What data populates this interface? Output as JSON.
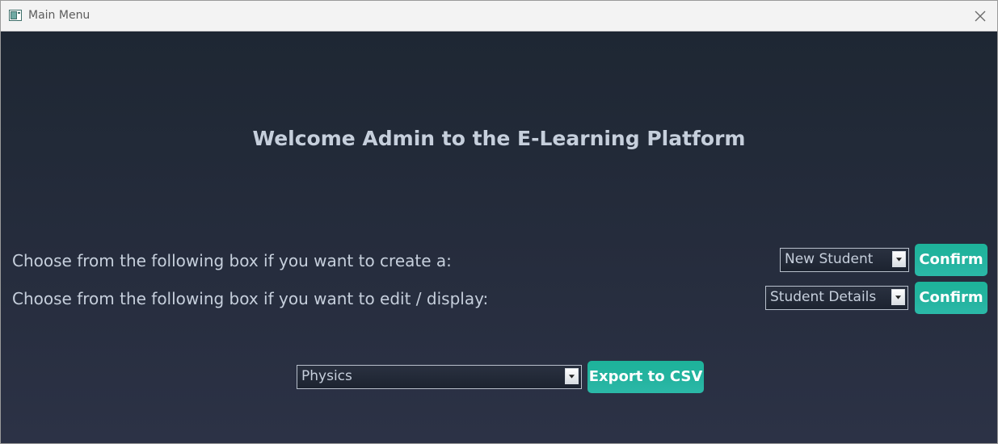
{
  "window": {
    "title": "Main Menu"
  },
  "main": {
    "heading": "Welcome Admin to the E-Learning Platform",
    "create_row": {
      "label": "Choose from the following box if you want to create a:",
      "selected": "New Student",
      "button": "Confirm"
    },
    "edit_row": {
      "label": "Choose from the following box if you want to edit / display:",
      "selected": "Student Details",
      "button": "Confirm"
    },
    "export_row": {
      "selected": "Physics",
      "button": "Export to CSV"
    }
  },
  "colors": {
    "background_top": "#1e2733",
    "background_bottom": "#2c3246",
    "text": "#c6cfdc",
    "accent": "#1db39a"
  },
  "icons": {
    "app": "window-icon",
    "close": "close-icon",
    "dropdown": "triangle-down-icon"
  }
}
